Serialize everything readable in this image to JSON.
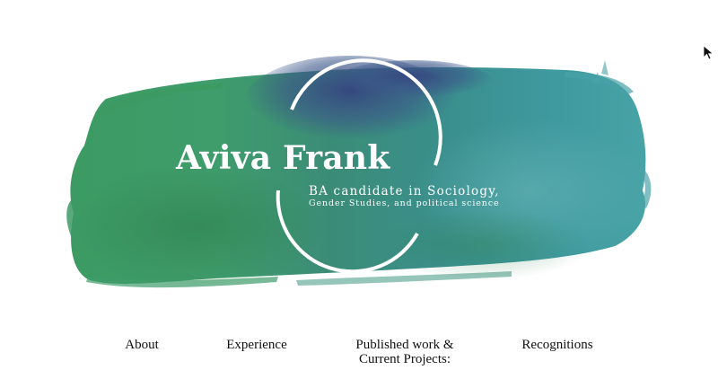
{
  "hero": {
    "name": "Aviva Frank",
    "subtitle_line1": "BA candidate in Sociology,",
    "subtitle_line2": "Gender Studies, and political science"
  },
  "nav": {
    "items": [
      {
        "label": "About"
      },
      {
        "label": "Experience"
      },
      {
        "label_line1": "Published work &",
        "label_line2": "Current Projects:"
      },
      {
        "label": "Recognitions"
      }
    ]
  },
  "colors": {
    "brush_green": "#3f9a6a",
    "brush_teal": "#3a8f95",
    "brush_indigo": "#3c4f86",
    "text_on_brush": "#ffffff",
    "nav_text": "#111111"
  },
  "icons": {
    "cursor": "mouse-pointer-icon"
  }
}
